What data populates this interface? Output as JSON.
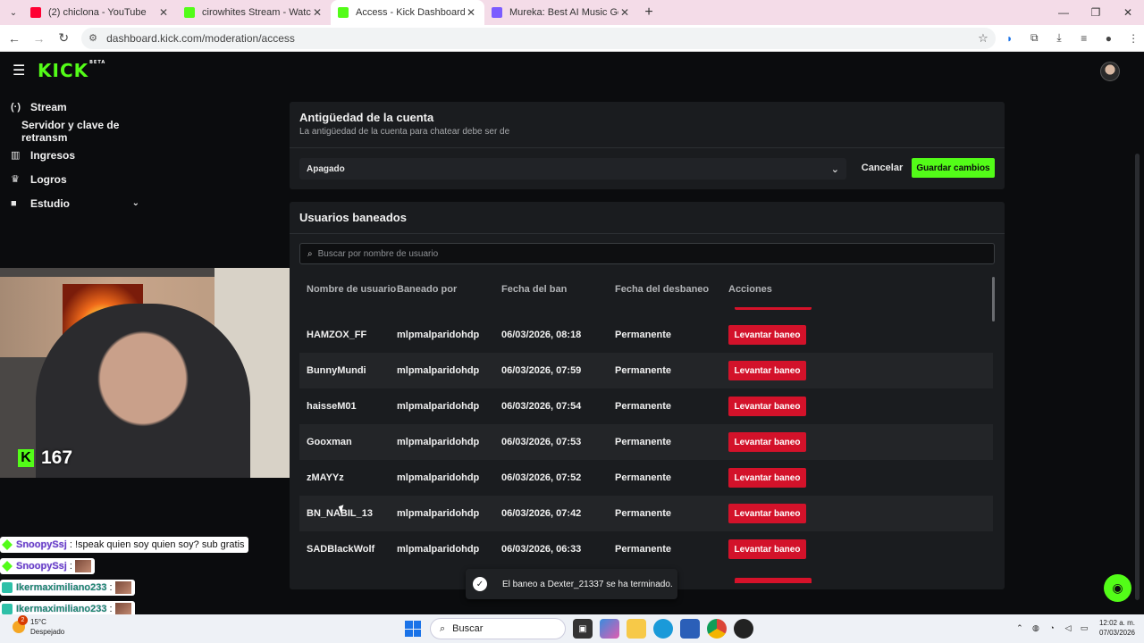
{
  "browser": {
    "tabs": [
      {
        "title": "(2) chiclona - YouTube",
        "favicon_color": "#ff0033",
        "active": false
      },
      {
        "title": "cirowhites Stream - Watch Live",
        "favicon_color": "#53fc18",
        "active": false
      },
      {
        "title": "Access - Kick Dashboard",
        "favicon_color": "#53fc18",
        "active": true
      },
      {
        "title": "Mureka: Best AI Music Generat",
        "favicon_color": "#7b5cff",
        "active": false
      }
    ],
    "url": "dashboard.kick.com/moderation/access"
  },
  "kick": {
    "logo": "KICK",
    "beta": "BETA",
    "sidebar": [
      {
        "label": "Stream",
        "icon": "broadcast-icon",
        "glyph": "(·)"
      },
      {
        "label": "Servidor y clave de retransm",
        "sub": true
      },
      {
        "label": "Ingresos",
        "icon": "chart-icon",
        "glyph": "▥"
      },
      {
        "label": "Logros",
        "icon": "trophy-icon",
        "glyph": "♛"
      },
      {
        "label": "Estudio",
        "icon": "video-icon",
        "glyph": "■"
      }
    ]
  },
  "overlay": {
    "viewers": "167",
    "chat": [
      {
        "name": "SnoopySsj",
        "text": ": !speak quien soy quien soy? sub gratis",
        "emote": false,
        "badge": "green"
      },
      {
        "name": "SnoopySsj",
        "text": ":",
        "emote": true,
        "badge": "green"
      },
      {
        "name": "Ikermaximiliano233",
        "text": ":",
        "emote": true,
        "badge": "blue"
      },
      {
        "name": "Ikermaximiliano233",
        "text": ":",
        "emote": true,
        "badge": "blue"
      }
    ]
  },
  "account_age": {
    "title": "Antigüedad de la cuenta",
    "description": "La antigüedad de la cuenta para chatear debe ser de",
    "selected": "Apagado",
    "cancel": "Cancelar",
    "save": "Guardar cambios"
  },
  "bans": {
    "title": "Usuarios baneados",
    "search_placeholder": "Buscar por nombre de usuario",
    "columns": [
      "Nombre de usuario",
      "Baneado por",
      "Fecha del ban",
      "Fecha del desbaneo",
      "Acciones"
    ],
    "unban_label": "Levantar baneo",
    "rows": [
      {
        "user": "HAMZOX_FF",
        "by": "mlpmalparidohdp",
        "date": "06/03/2026, 08:18",
        "until": "Permanente"
      },
      {
        "user": "BunnyMundi",
        "by": "mlpmalparidohdp",
        "date": "06/03/2026, 07:59",
        "until": "Permanente"
      },
      {
        "user": "haisseM01",
        "by": "mlpmalparidohdp",
        "date": "06/03/2026, 07:54",
        "until": "Permanente"
      },
      {
        "user": "Gooxman",
        "by": "mlpmalparidohdp",
        "date": "06/03/2026, 07:53",
        "until": "Permanente"
      },
      {
        "user": "zMAYYz",
        "by": "mlpmalparidohdp",
        "date": "06/03/2026, 07:52",
        "until": "Permanente"
      },
      {
        "user": "BN_NABIL_13",
        "by": "mlpmalparidohdp",
        "date": "06/03/2026, 07:42",
        "until": "Permanente"
      },
      {
        "user": "SADBlackWolf",
        "by": "mlpmalparidohdp",
        "date": "06/03/2026, 06:33",
        "until": "Permanente"
      }
    ]
  },
  "toast": "El baneo a Dexter_21337 se ha terminado.",
  "taskbar": {
    "temp": "15°C",
    "weather": "Despejado",
    "notif_count": "2",
    "search": "Buscar",
    "time": "12:02 a. m.",
    "date": "07/03/2026"
  },
  "colors": {
    "kick_green": "#53fc18",
    "unban_red": "#d3122a",
    "panel": "#1a1c1f"
  }
}
